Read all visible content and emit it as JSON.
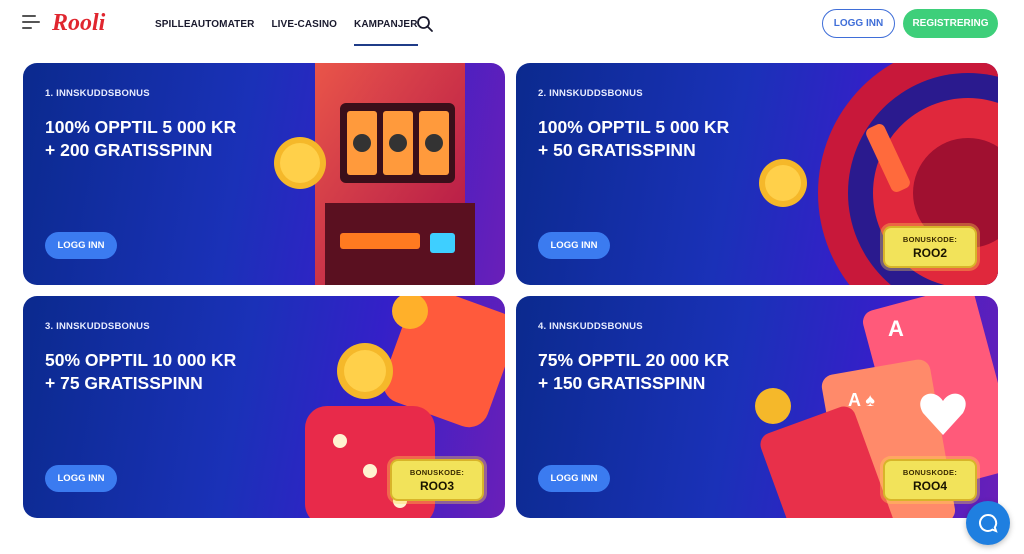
{
  "header": {
    "logo_text": "Rooli",
    "nav": [
      {
        "label": "SPILLEAUTOMATER",
        "active": false
      },
      {
        "label": "LIVE-CASINO",
        "active": false
      },
      {
        "label": "KAMPANJER",
        "active": true
      }
    ],
    "login_label": "LOGG INN",
    "register_label": "REGISTRERING"
  },
  "promos": [
    {
      "label": "1. INNSKUDDSBONUS",
      "line1": "100% OPPTIL 5 000 KR",
      "line2": "+ 200 GRATISSPINN",
      "button": "LOGG INN",
      "art": "slot-machine"
    },
    {
      "label": "2. INNSKUDDSBONUS",
      "line1": "100% OPPTIL 5 000 KR",
      "line2": "+ 50 GRATISSPINN",
      "button": "LOGG INN",
      "art": "roulette-wheel",
      "bonus_key": "BONUSKODE:",
      "bonus_code": "ROO2"
    },
    {
      "label": "3. INNSKUDDSBONUS",
      "line1": "50% OPPTIL 10 000 KR",
      "line2": "+ 75 GRATISSPINN",
      "button": "LOGG INN",
      "art": "dice",
      "bonus_key": "BONUSKODE:",
      "bonus_code": "ROO3"
    },
    {
      "label": "4. INNSKUDDSBONUS",
      "line1": "75% OPPTIL 20 000 KR",
      "line2": "+ 150 GRATISSPINN",
      "button": "LOGG INN",
      "art": "playing-cards",
      "bonus_key": "BONUSKODE:",
      "bonus_code": "ROO4"
    }
  ],
  "colors": {
    "brand_red": "#e0262f",
    "login_blue": "#3f6ed8",
    "register_green": "#3ecf7a",
    "card_button": "#3b7bf0",
    "badge_yellow": "#f2e35a",
    "chat_blue": "#1f7fe0"
  },
  "icons": {
    "menu": "hamburger-icon",
    "search": "search-icon",
    "chat": "chat-bubble-icon"
  }
}
